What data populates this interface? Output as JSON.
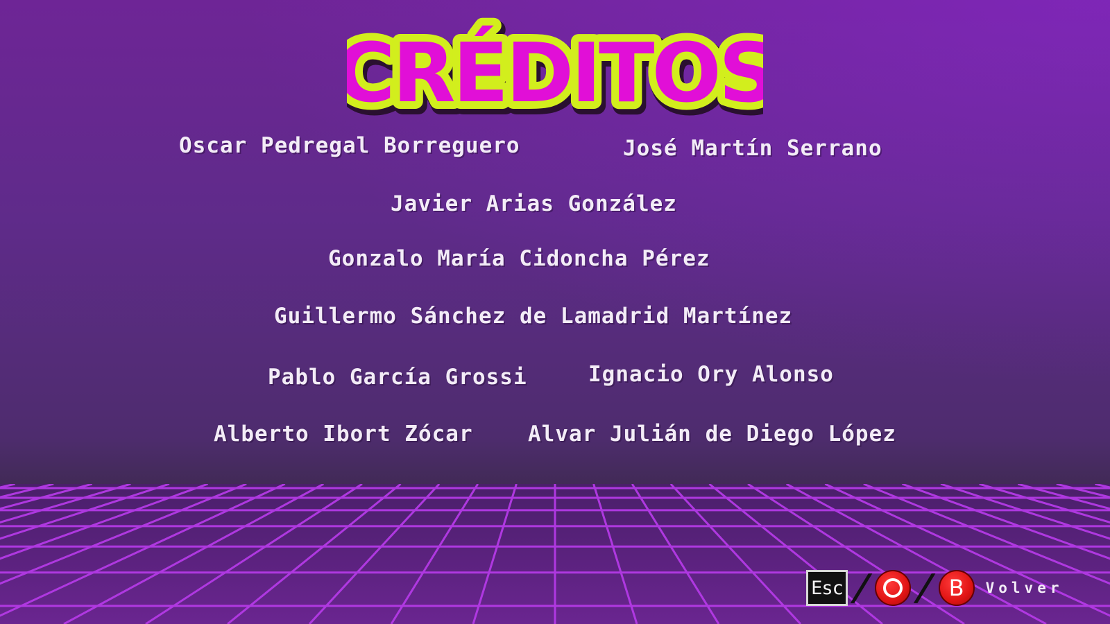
{
  "title": "CRÉDITOS",
  "credits": [
    "Oscar Pedregal Borreguero",
    "José Martín Serrano",
    "Javier Arias González",
    "Gonzalo María Cidoncha Pérez",
    "Guillermo Sánchez de Lamadrid Martínez",
    "Pablo García Grossi",
    "Ignacio Ory Alonso",
    "Alberto Ibort Zócar",
    "Alvar Julián de Diego López"
  ],
  "back_hint": {
    "esc_key": "Esc",
    "slash": "/",
    "circle_button_icon": "circle-button-icon",
    "b_button": "B",
    "label": "Volver"
  },
  "colors": {
    "title_fill": "#e10fd7",
    "title_outline": "#d2ee1d",
    "grid_line": "#b43ae6",
    "text": "#f3ecf7",
    "button_red": "#e01414"
  }
}
